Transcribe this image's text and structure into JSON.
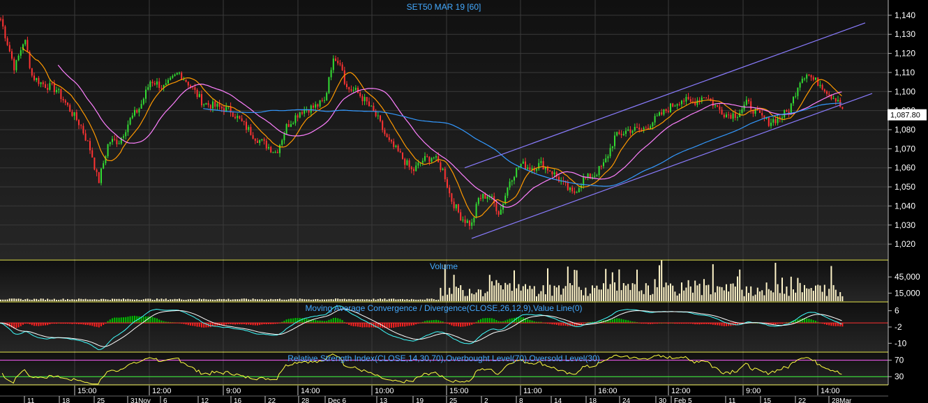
{
  "chart_data": [
    {
      "type": "candlestick",
      "title": "SET50 MAR 19   [60]",
      "ylim": [
        1012,
        1148
      ],
      "y_ticks": [
        1020,
        1030,
        1040,
        1050,
        1060,
        1070,
        1080,
        1090,
        1100,
        1110,
        1120,
        1130,
        1140
      ],
      "y_tick_labels": [
        "1,020",
        "1,030",
        "1,040",
        "1,050",
        "1,060",
        "1,070",
        "1,080",
        "1,090",
        "1,100",
        "1,110",
        "1,120",
        "1,130",
        "1,140"
      ],
      "last_price_label": "1,087.80",
      "last_price": 1087.8,
      "close_path": [
        [
          0,
          1138
        ],
        [
          20,
          1112
        ],
        [
          34,
          1128
        ],
        [
          45,
          1108
        ],
        [
          60,
          1104
        ],
        [
          80,
          1101
        ],
        [
          100,
          1090
        ],
        [
          115,
          1082
        ],
        [
          130,
          1068
        ],
        [
          140,
          1052
        ],
        [
          155,
          1074
        ],
        [
          170,
          1074
        ],
        [
          185,
          1085
        ],
        [
          200,
          1092
        ],
        [
          215,
          1106
        ],
        [
          235,
          1102
        ],
        [
          255,
          1110
        ],
        [
          270,
          1104
        ],
        [
          290,
          1094
        ],
        [
          310,
          1092
        ],
        [
          330,
          1090
        ],
        [
          350,
          1082
        ],
        [
          365,
          1076
        ],
        [
          380,
          1072
        ],
        [
          395,
          1068
        ],
        [
          410,
          1082
        ],
        [
          430,
          1090
        ],
        [
          450,
          1092
        ],
        [
          465,
          1095
        ],
        [
          472,
          1112
        ],
        [
          480,
          1118
        ],
        [
          488,
          1115
        ],
        [
          495,
          1102
        ],
        [
          510,
          1100
        ],
        [
          525,
          1094
        ],
        [
          540,
          1086
        ],
        [
          555,
          1074
        ],
        [
          570,
          1068
        ],
        [
          590,
          1058
        ],
        [
          605,
          1064
        ],
        [
          620,
          1066
        ],
        [
          635,
          1058
        ],
        [
          645,
          1044
        ],
        [
          660,
          1034
        ],
        [
          675,
          1030
        ],
        [
          685,
          1044
        ],
        [
          700,
          1046
        ],
        [
          715,
          1036
        ],
        [
          730,
          1054
        ],
        [
          745,
          1062
        ],
        [
          760,
          1060
        ],
        [
          775,
          1062
        ],
        [
          790,
          1058
        ],
        [
          805,
          1052
        ],
        [
          820,
          1046
        ],
        [
          835,
          1054
        ],
        [
          850,
          1056
        ],
        [
          865,
          1062
        ],
        [
          880,
          1076
        ],
        [
          900,
          1080
        ],
        [
          920,
          1080
        ],
        [
          940,
          1086
        ],
        [
          960,
          1092
        ],
        [
          975,
          1096
        ],
        [
          990,
          1094
        ],
        [
          1010,
          1098
        ],
        [
          1025,
          1092
        ],
        [
          1040,
          1088
        ],
        [
          1055,
          1088
        ],
        [
          1070,
          1094
        ],
        [
          1085,
          1088
        ],
        [
          1100,
          1084
        ],
        [
          1115,
          1086
        ],
        [
          1130,
          1090
        ],
        [
          1145,
          1106
        ],
        [
          1155,
          1110
        ],
        [
          1165,
          1106
        ],
        [
          1175,
          1104
        ],
        [
          1190,
          1098
        ],
        [
          1200,
          1096
        ],
        [
          1208,
          1088
        ]
      ],
      "moving_averages": [
        {
          "color": "#ff9900",
          "period": 10
        },
        {
          "color": "#ff80ff",
          "period": 26
        },
        {
          "color": "#3399ff",
          "period": 75
        }
      ],
      "trend_channel": {
        "color": "#8a7cff",
        "lower": [
          [
            676,
            1023
          ],
          [
            1250,
            1099
          ]
        ],
        "upper": [
          [
            666,
            1060
          ],
          [
            1240,
            1136
          ]
        ]
      },
      "x_ticks_time": [
        "15:00",
        "12:00",
        "9:00",
        "14:00",
        "10:00",
        "15:00",
        "11:00",
        "16:00",
        "12:00",
        "9:00",
        "14:00"
      ],
      "x_ticks_date": [
        "11",
        "18",
        "25",
        "31Nov",
        "6",
        "12",
        "16",
        "22",
        "28",
        "Dec 6",
        "13",
        "19",
        "25",
        "2",
        "8",
        "14",
        "18",
        "24",
        "30",
        "Feb 5",
        "11",
        "15",
        "22",
        "28Mar"
      ]
    },
    {
      "type": "bar",
      "title": "Volume",
      "y_tick_labels": [
        "45,000",
        "15,000"
      ],
      "y_ticks": [
        45000,
        15000
      ],
      "ylim": [
        0,
        75000
      ],
      "color": "#fff4c8"
    },
    {
      "type": "line",
      "title": "Moving Average Convergence / Divergence(CLOSE,26,12,9),Value Line(0)",
      "y_tick_labels": [
        "6",
        "-2",
        "-10"
      ],
      "y_ticks": [
        6,
        -2,
        -10
      ],
      "ylim": [
        -14,
        10
      ],
      "colors": {
        "macd": "#40ffff",
        "signal": "#ffffff",
        "hist_up": "#00c000",
        "hist_down": "#ff2020",
        "value_line": "#ff3030"
      }
    },
    {
      "type": "line",
      "title": "Relative Strength Index(CLOSE,14,30,70),Overbought Level(70),Oversold Level(30)",
      "y_tick_labels": [
        "70",
        "30"
      ],
      "y_ticks": [
        70,
        30
      ],
      "ylim": [
        10,
        88
      ],
      "colors": {
        "rsi": "#ffff40",
        "overbought": "#ff60ff",
        "oversold": "#40ff40"
      }
    }
  ],
  "colors": {
    "up": "#33dd33",
    "down": "#ff3333",
    "title": "#44aaff",
    "panel_border": "#ffff66",
    "grid": "#3a3a3a"
  }
}
